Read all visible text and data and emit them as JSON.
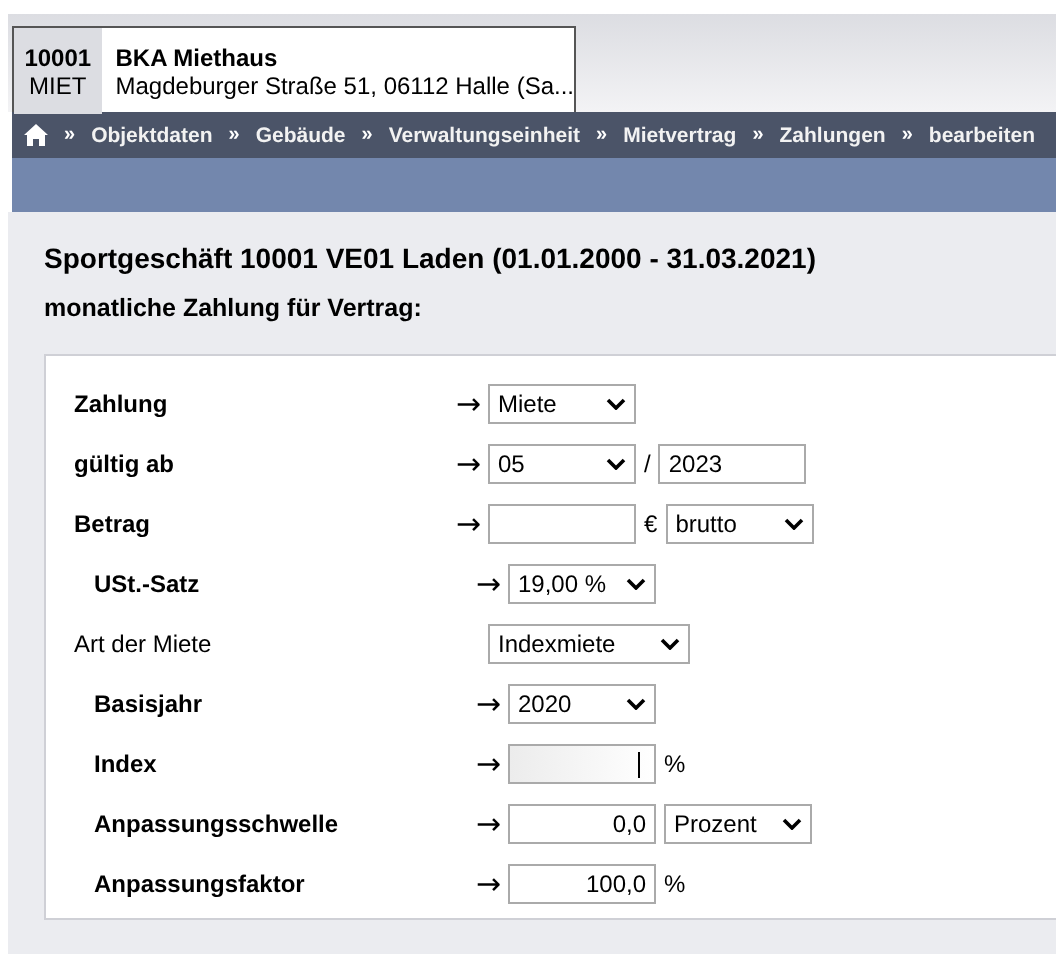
{
  "object_tab": {
    "code": "10001",
    "type": "MIET",
    "name": "BKA Miethaus",
    "address": "Magdeburger Straße 51, 06112 Halle (Sa..."
  },
  "breadcrumb": {
    "separator": "»",
    "items": [
      "Objektdaten",
      "Gebäude",
      "Verwaltungseinheit",
      "Mietvertrag",
      "Zahlungen",
      "bearbeiten"
    ]
  },
  "heading": "Sportgeschäft 10001 VE01 Laden (01.01.2000 - 31.03.2021)",
  "subheading": "monatliche Zahlung für Vertrag:",
  "form": [
    {
      "label": "Zahlung",
      "bold": true,
      "arrow": "→",
      "controls": [
        {
          "kind": "select",
          "value": "Miete"
        }
      ]
    },
    {
      "label": "gültig ab",
      "bold": true,
      "arrow": "→",
      "controls": [
        {
          "kind": "select",
          "value": "05"
        },
        {
          "kind": "unit",
          "text": "/"
        },
        {
          "kind": "text",
          "value": "2023",
          "readonly": false
        }
      ]
    },
    {
      "label": "Betrag",
      "bold": true,
      "arrow": "→",
      "controls": [
        {
          "kind": "text",
          "readonly": false
        },
        {
          "kind": "unit",
          "text": "€"
        },
        {
          "kind": "select",
          "value": "brutto"
        }
      ],
      "children": [
        {
          "label": "USt.-Satz",
          "bold": true,
          "arrow": "→",
          "controls": [
            {
              "kind": "select",
              "value": "19,00 %"
            }
          ]
        }
      ]
    },
    {
      "label": "Art der Miete",
      "bold": false,
      "controls": [
        {
          "kind": "select",
          "value": "Indexmiete"
        }
      ],
      "children": [
        {
          "label": "Basisjahr",
          "bold": true,
          "arrow": "→",
          "controls": [
            {
              "kind": "select",
              "value": "2020"
            }
          ]
        },
        {
          "label": "Index",
          "bold": true,
          "arrow": "→",
          "controls": [
            {
              "kind": "text",
              "readonly": true
            },
            {
              "kind": "unit",
              "text": "%"
            }
          ]
        },
        {
          "label": "Anpassungsschwelle",
          "bold": true,
          "arrow": "→",
          "controls": [
            {
              "kind": "number",
              "value": "0,0",
              "readonly": false
            },
            {
              "kind": "select",
              "value": "Prozent"
            }
          ]
        },
        {
          "label": "Anpassungsfaktor",
          "bold": true,
          "arrow": "→",
          "controls": [
            {
              "kind": "number",
              "value": "100,0",
              "readonly": false
            },
            {
              "kind": "unit",
              "text": "%"
            }
          ]
        }
      ]
    }
  ]
}
